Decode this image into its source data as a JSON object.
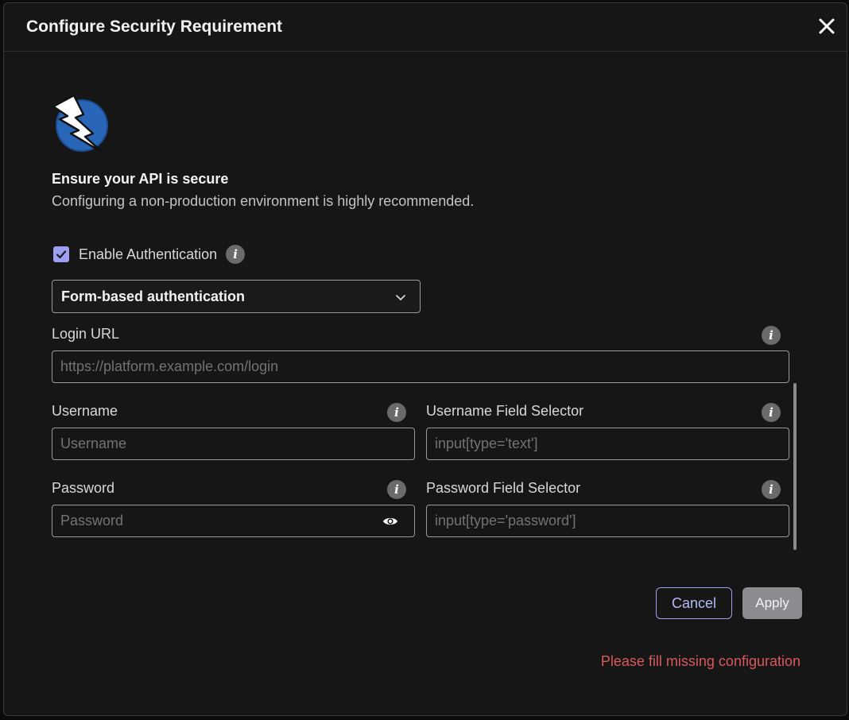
{
  "modal": {
    "title": "Configure Security Requirement",
    "close_icon": "close-icon"
  },
  "intro": {
    "logo_icon": "lightning-bolt-logo",
    "heading": "Ensure your API is secure",
    "subheading": "Configuring a non-production environment is highly recommended."
  },
  "auth": {
    "enable_label": "Enable Authentication",
    "enabled": true,
    "method_selected": "Form-based authentication"
  },
  "fields": {
    "login_url": {
      "label": "Login URL",
      "value": "",
      "placeholder": "https://platform.example.com/login"
    },
    "username": {
      "label": "Username",
      "value": "",
      "placeholder": "Username"
    },
    "username_selector": {
      "label": "Username Field Selector",
      "value": "",
      "placeholder": "input[type='text']"
    },
    "password": {
      "label": "Password",
      "value": "",
      "placeholder": "Password"
    },
    "password_selector": {
      "label": "Password Field Selector",
      "value": "",
      "placeholder": "input[type='password']"
    }
  },
  "actions": {
    "cancel_label": "Cancel",
    "apply_label": "Apply"
  },
  "status": {
    "error": "Please fill missing configuration"
  },
  "colors": {
    "accent": "#9d9ff2",
    "error": "#d9595b",
    "background": "#161616"
  }
}
